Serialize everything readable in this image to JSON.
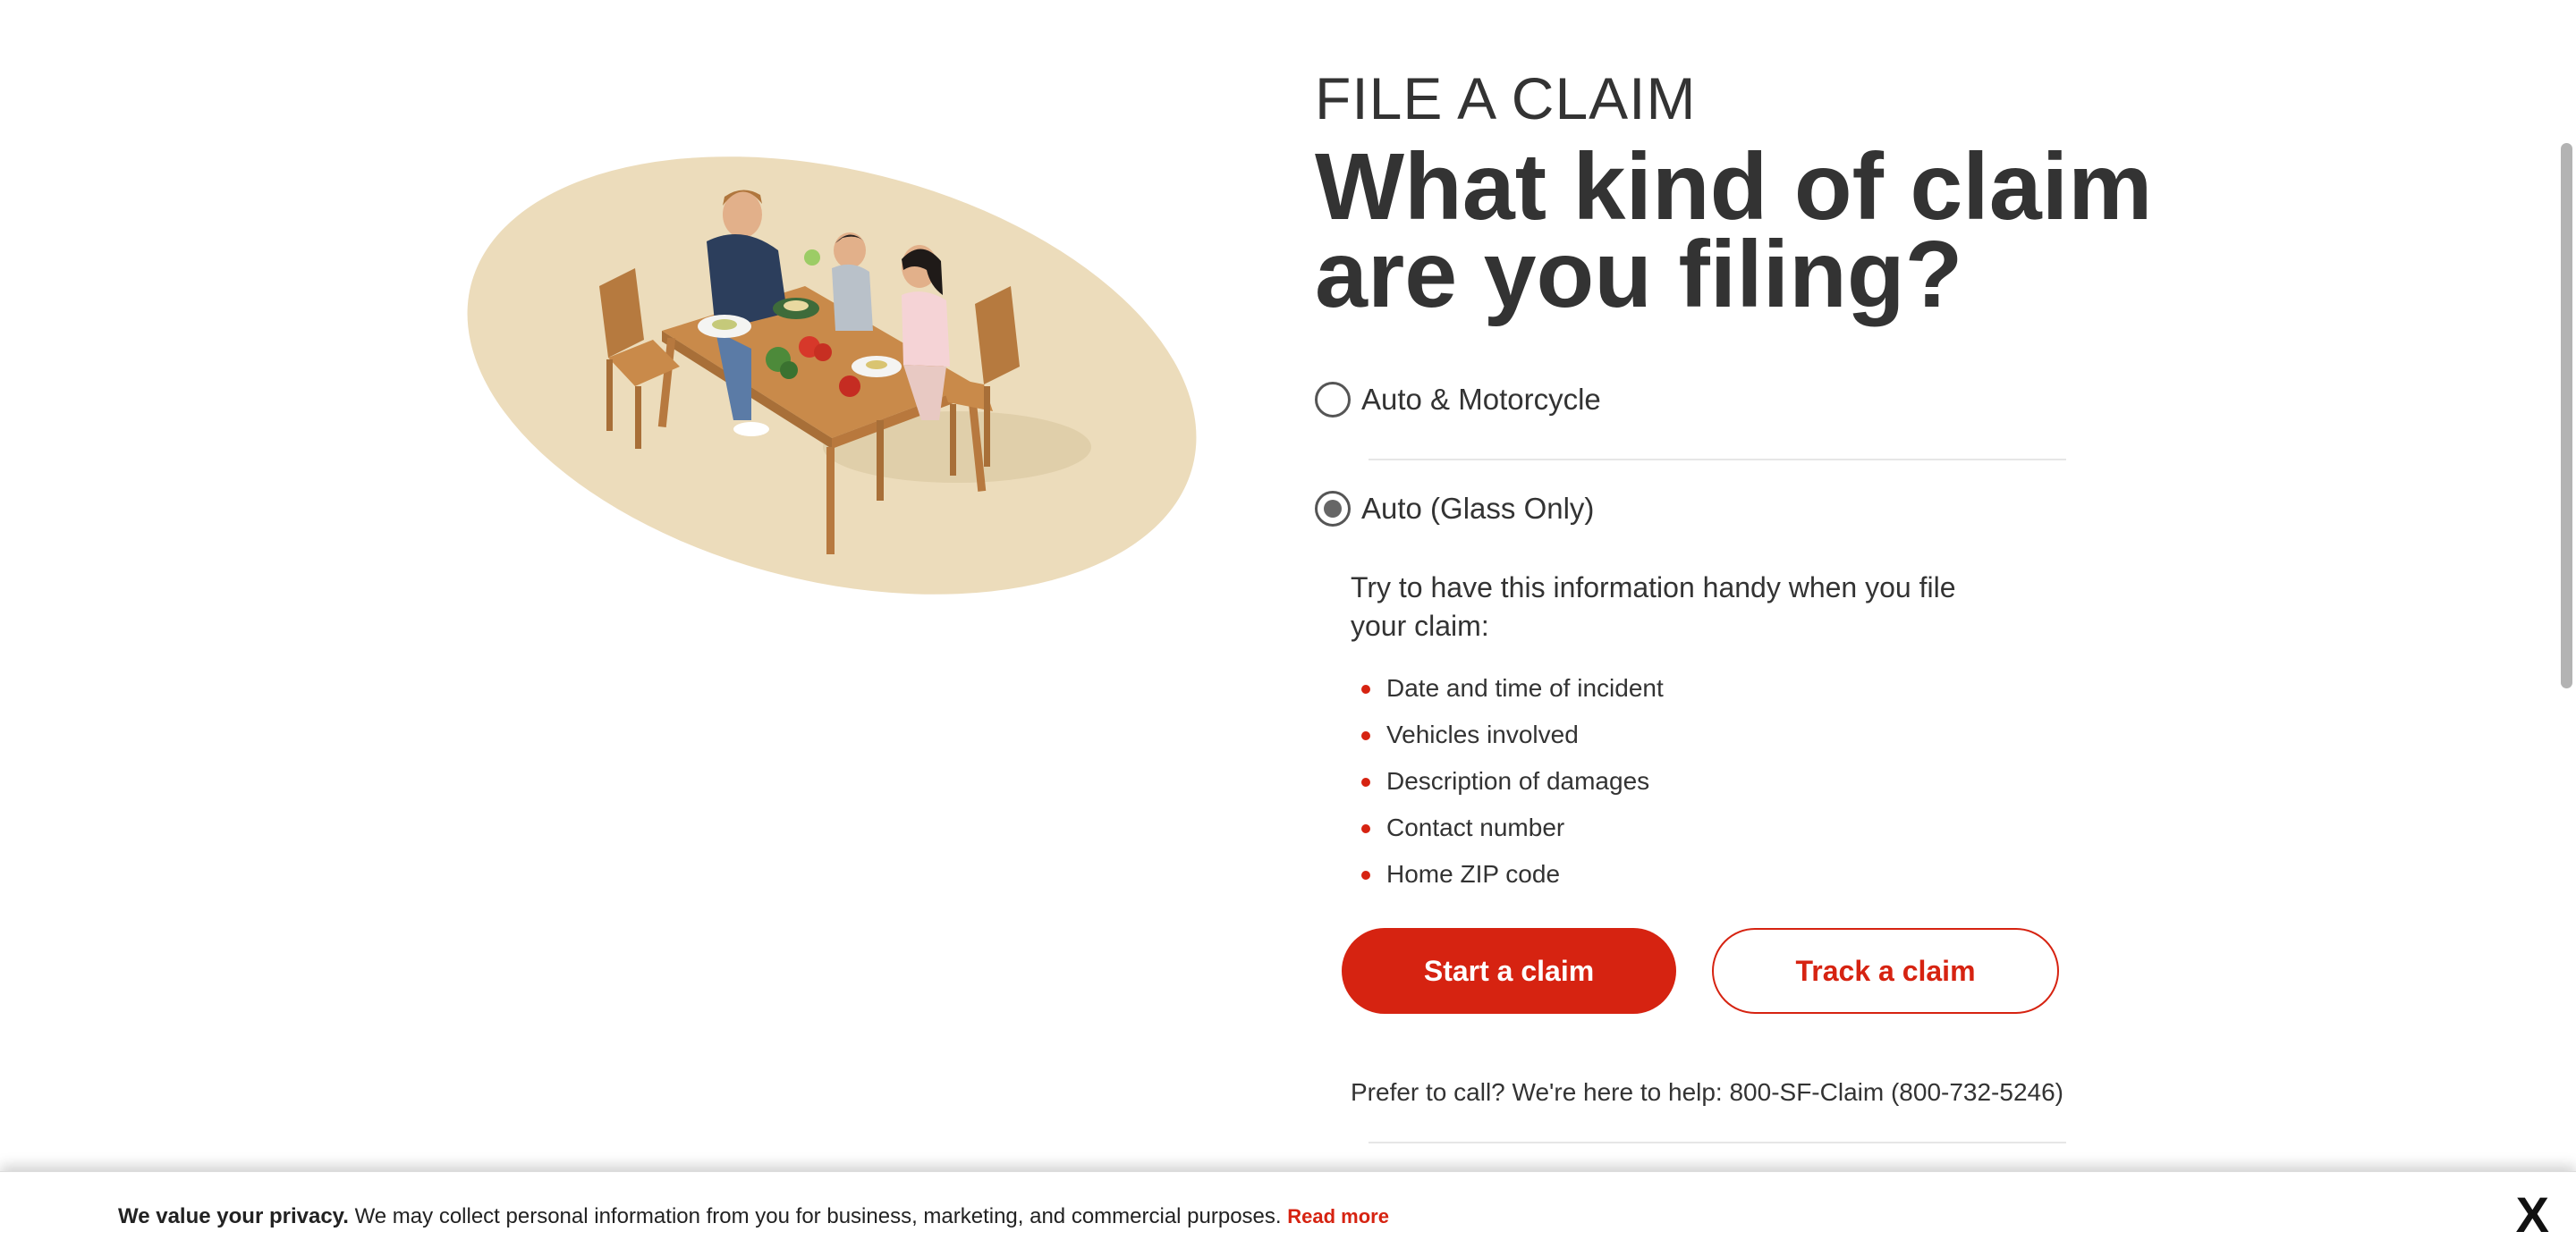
{
  "header": {
    "eyebrow": "FILE A CLAIM",
    "headline": "What kind of claim are you filing?"
  },
  "claim_types": [
    {
      "label": "Auto & Motorcycle",
      "selected": false
    },
    {
      "label": "Auto (Glass Only)",
      "selected": true
    }
  ],
  "info": {
    "intro": "Try to have this information handy when you file your claim:",
    "items": [
      "Date and time of incident",
      "Vehicles involved",
      "Description of damages",
      "Contact number",
      "Home ZIP code"
    ]
  },
  "actions": {
    "start_label": "Start a claim",
    "track_label": "Track a claim"
  },
  "call": {
    "text": "Prefer to call? We're here to help: 800-SF-Claim (800-732-5246)"
  },
  "privacy": {
    "bold": "We value your privacy.",
    "text": " We may collect personal information from you for business, marketing, and commercial purposes. ",
    "link": "Read more",
    "close": "X"
  },
  "colors": {
    "brand_red": "#d62311",
    "text": "#333333",
    "illustration_bg": "#ecdcbb"
  }
}
